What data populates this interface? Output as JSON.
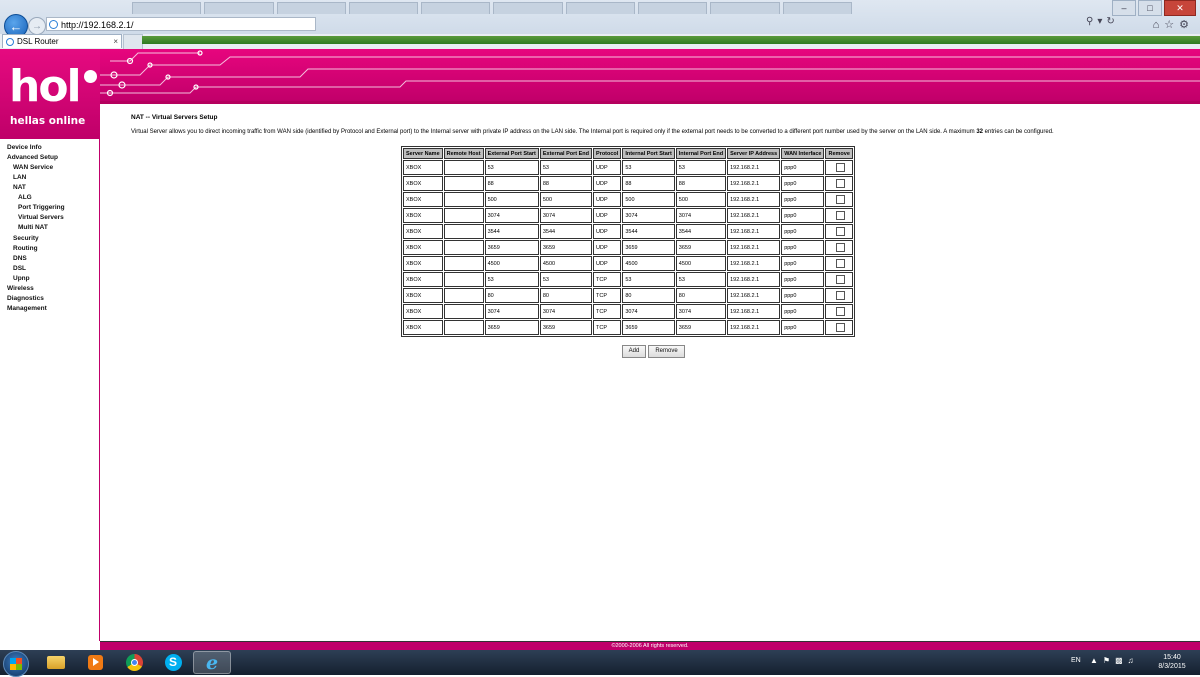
{
  "browser": {
    "address": "http://192.168.2.1/",
    "tab_title": "DSL Router",
    "tab_close": "×"
  },
  "logo": {
    "main": "hol",
    "sub": "hellas online"
  },
  "menu": [
    {
      "label": "Device Info"
    },
    {
      "label": "Advanced Setup"
    },
    {
      "label": "WAN Service"
    },
    {
      "label": "LAN"
    },
    {
      "label": "NAT"
    },
    {
      "label": "ALG"
    },
    {
      "label": "Port Triggering"
    },
    {
      "label": "Virtual Servers"
    },
    {
      "label": "Multi NAT"
    },
    {
      "label": "Security"
    },
    {
      "label": "Routing"
    },
    {
      "label": "DNS"
    },
    {
      "label": "DSL"
    },
    {
      "label": "Upnp"
    },
    {
      "label": "Wireless"
    },
    {
      "label": "Diagnostics"
    },
    {
      "label": "Management"
    }
  ],
  "page": {
    "heading": "NAT -- Virtual Servers Setup",
    "description_pre": "Virtual Server allows you to direct incoming traffic from WAN side (identified by Protocol and External port) to the Internal server with private IP address on the LAN side. The Internal port is required only if the external port needs to be converted to a different port number used by the server on the LAN side. A maximum ",
    "description_max": "32",
    "description_post": " entries can be configured."
  },
  "table": {
    "headers": [
      "Server Name",
      "Remote Host",
      "External Port Start",
      "External Port End",
      "Protocol",
      "Internal Port Start",
      "Internal Port End",
      "Server IP Address",
      "WAN Interface",
      "Remove"
    ],
    "rows": [
      [
        "XBOX",
        "",
        "53",
        "53",
        "UDP",
        "53",
        "53",
        "192.168.2.1",
        "ppp0"
      ],
      [
        "XBOX",
        "",
        "88",
        "88",
        "UDP",
        "88",
        "88",
        "192.168.2.1",
        "ppp0"
      ],
      [
        "XBOX",
        "",
        "500",
        "500",
        "UDP",
        "500",
        "500",
        "192.168.2.1",
        "ppp0"
      ],
      [
        "XBOX",
        "",
        "3074",
        "3074",
        "UDP",
        "3074",
        "3074",
        "192.168.2.1",
        "ppp0"
      ],
      [
        "XBOX",
        "",
        "3544",
        "3544",
        "UDP",
        "3544",
        "3544",
        "192.168.2.1",
        "ppp0"
      ],
      [
        "XBOX",
        "",
        "3659",
        "3659",
        "UDP",
        "3659",
        "3659",
        "192.168.2.1",
        "ppp0"
      ],
      [
        "XBOX",
        "",
        "4500",
        "4500",
        "UDP",
        "4500",
        "4500",
        "192.168.2.1",
        "ppp0"
      ],
      [
        "XBOX",
        "",
        "53",
        "53",
        "TCP",
        "53",
        "53",
        "192.168.2.1",
        "ppp0"
      ],
      [
        "XBOX",
        "",
        "80",
        "80",
        "TCP",
        "80",
        "80",
        "192.168.2.1",
        "ppp0"
      ],
      [
        "XBOX",
        "",
        "3074",
        "3074",
        "TCP",
        "3074",
        "3074",
        "192.168.2.1",
        "ppp0"
      ],
      [
        "XBOX",
        "",
        "3659",
        "3659",
        "TCP",
        "3659",
        "3659",
        "192.168.2.1",
        "ppp0"
      ]
    ]
  },
  "buttons": {
    "add": "Add",
    "remove": "Remove"
  },
  "footer": "©2000-2006 All rights reserved.",
  "taskbar": {
    "language": "EN",
    "time": "15:40",
    "date": "8/3/2015",
    "icons": [
      "start-icon",
      "explorer-icon",
      "media-player-icon",
      "chrome-icon",
      "skype-icon",
      "ie-icon"
    ]
  },
  "colors": {
    "brand": "#d4007a",
    "header_bg": "#bfbfbf"
  }
}
